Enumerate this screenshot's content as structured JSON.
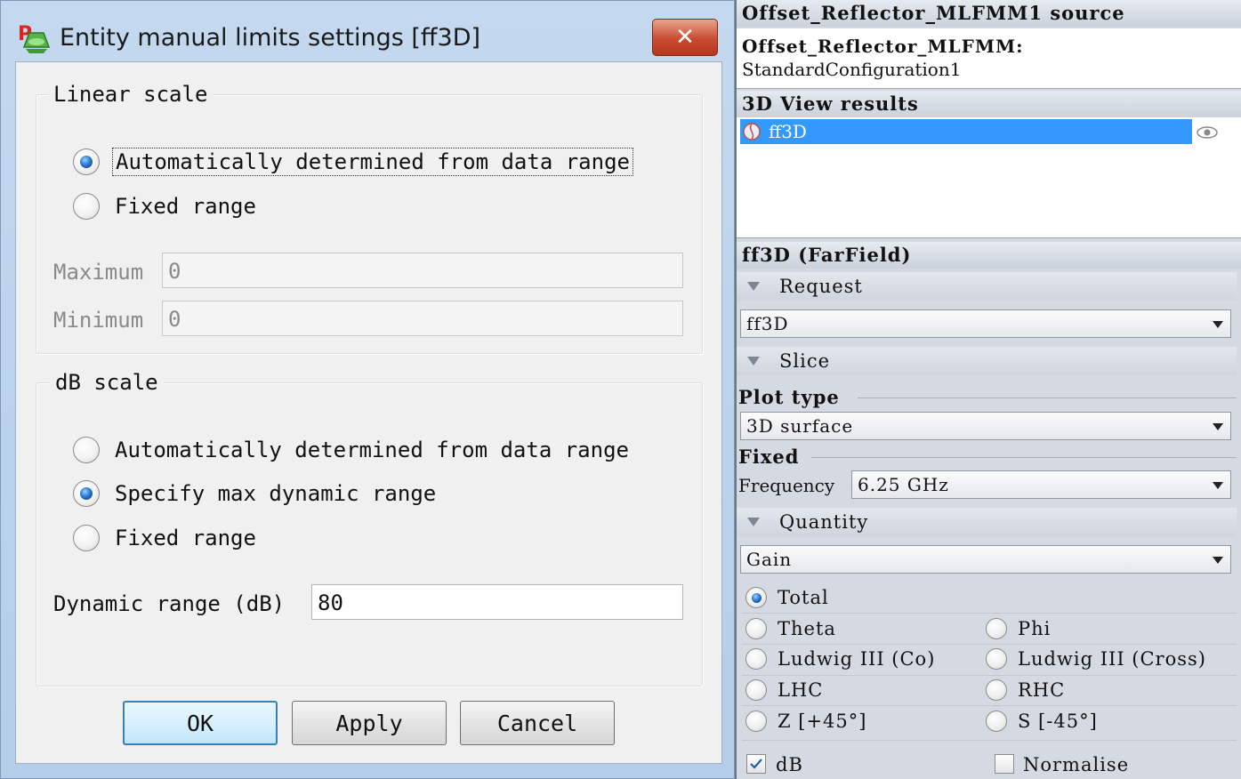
{
  "dialog": {
    "title": "Entity manual limits settings [ff3D]",
    "close_symbol": "✕",
    "linear": {
      "group_title": "Linear scale",
      "auto_label": "Automatically determined from data range",
      "fixed_label": "Fixed range",
      "maximum_label": "Maximum",
      "maximum_value": "0",
      "minimum_label": "Minimum",
      "minimum_value": "0"
    },
    "db": {
      "group_title": "dB scale",
      "auto_label": "Automatically determined from data range",
      "specify_label": "Specify max dynamic range",
      "fixed_label": "Fixed range",
      "dynamic_label": "Dynamic range (dB)",
      "dynamic_value": "80"
    },
    "buttons": {
      "ok": "OK",
      "apply": "Apply",
      "cancel": "Cancel"
    }
  },
  "panel": {
    "source_header": "Offset_Reflector_MLFMM1 source",
    "source_name": "Offset_Reflector_MLFMM:",
    "source_config": "StandardConfiguration1",
    "results_header": "3D View results",
    "result_item": "ff3D",
    "entity_header": "ff3D (FarField)",
    "request_section": "Request",
    "request_value": "ff3D",
    "slice_section": "Slice",
    "plot_type_label": "Plot type",
    "plot_type_value": "3D surface",
    "fixed_label": "Fixed",
    "frequency_label": "Frequency",
    "frequency_value": "6.25 GHz",
    "quantity_section": "Quantity",
    "quantity_value": "Gain",
    "components": {
      "total": "Total",
      "theta": "Theta",
      "phi": "Phi",
      "ludwig_co": "Ludwig III (Co)",
      "ludwig_cross": "Ludwig III (Cross)",
      "lhc": "LHC",
      "rhc": "RHC",
      "z": "Z [+45°]",
      "s": "S [-45°]"
    },
    "db_label": "dB",
    "normalise_label": "Normalise"
  },
  "colors": {
    "selection": "#3399ff",
    "close_button": "#c94b31",
    "default_button_border": "#3c7fb1"
  },
  "icons": {
    "app": "app-icon",
    "close": "close-icon",
    "result": "result-icon",
    "visibility": "eye-icon"
  }
}
